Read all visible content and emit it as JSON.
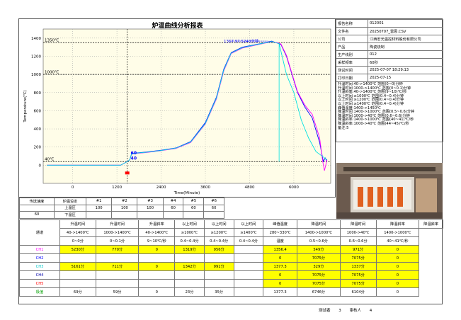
{
  "title": "炉温曲线分析报表",
  "info": [
    {
      "k": "报告名称",
      "v": "012001"
    },
    {
      "k": "文件名",
      "v": "20250707_雷恩.CSV"
    },
    {
      "k": "公司",
      "v": "江西宏光温控材料股份有限公司"
    },
    {
      "k": "产品",
      "v": "陶瓷烧制"
    },
    {
      "k": "生产线别",
      "v": "012"
    },
    {
      "k": "采样频率",
      "v": "60秒"
    },
    {
      "k": "测试时间",
      "v": "2025-07-07 18:29:13"
    },
    {
      "k": "打印日期",
      "v": "2025-07-15"
    }
  ],
  "notes": [
    "升温时间:40->1400℃ 范围(0~0)分钟",
    "升温时间:1000->1400℃ 范围(0~0.1)分钟",
    "升温斜率:40->1400℃ 范围(9~10)℃/秒",
    "以上时间:≥1000℃ 范围(0.4~0.4)分钟",
    "以上时间:≥1200℃ 范围(0.4~0.4)分钟",
    "以上时间:≥1400℃ 范围(0.4~0.4)分钟",
    "峰值温度:1400->1450℃",
    "降温时间:1400->1000℃ 范围(0.5~0.6)分钟",
    "降温时间:1000->40℃ 范围(0.6~0.6)分钟",
    "降温斜率:1400->1000℃ 范围(40~41)℃/秒",
    "降温斜率:1000->40℃ 范围(44~45)℃/秒",
    "备注:5"
  ],
  "chart_data": {
    "type": "line",
    "xlabel": "Time(Minute)",
    "ylabel": "Temperature(℃)",
    "xlim": [
      -800,
      7000
    ],
    "ylim": [
      -200,
      1500
    ],
    "xticks": [
      0,
      1200,
      2400,
      3600,
      4800,
      6000
    ],
    "yticks": [
      0,
      200,
      400,
      600,
      800,
      1000,
      1200,
      1400
    ],
    "ref_lines": [
      {
        "y": 1350,
        "label": "1350℃"
      },
      {
        "y": 1000,
        "label": "1000℃"
      },
      {
        "y": 40,
        "label": "40℃"
      }
    ],
    "vline": 1480,
    "peak_label": "1367.97 5243分钟",
    "start_label": "60",
    "start_label2": "40",
    "series": [
      {
        "color": "#0000ff",
        "x": [
          -700,
          0,
          1300,
          1480,
          1550,
          1600,
          2000,
          2400,
          2800,
          3200,
          3600,
          3900,
          4100,
          4300,
          4600,
          5100,
          5400,
          5550,
          5650,
          5800,
          5950,
          6100,
          6300,
          6500,
          6700,
          6800,
          6850,
          6900
        ],
        "y": [
          0,
          0,
          0,
          40,
          60,
          130,
          145,
          165,
          190,
          260,
          470,
          750,
          1060,
          1240,
          1300,
          1340,
          1367,
          1345,
          1330,
          1200,
          1000,
          800,
          640,
          520,
          250,
          40,
          80,
          40
        ]
      },
      {
        "color": "#ff00ff",
        "x": [
          -700,
          0,
          1300,
          1480,
          1550,
          1600,
          2000,
          2400,
          2800,
          3200,
          3600,
          3900,
          4100,
          4300,
          4600,
          5100,
          5400,
          5550,
          5650,
          5800,
          5950,
          6100,
          6300,
          6500,
          6700,
          6780,
          6830,
          6900
        ],
        "y": [
          0,
          0,
          0,
          40,
          60,
          125,
          140,
          160,
          185,
          250,
          455,
          730,
          1040,
          1230,
          1290,
          1335,
          1360,
          1350,
          1335,
          1210,
          1010,
          810,
          660,
          560,
          300,
          50,
          -60,
          60
        ]
      },
      {
        "color": "#00e0e0",
        "x": [
          -700,
          0,
          1300,
          1480,
          1550,
          1600,
          2000,
          2400,
          2800,
          3200,
          3600,
          3900,
          4100,
          4300,
          4600,
          5100,
          5400,
          5550,
          5600,
          5800,
          6000,
          6200,
          6400,
          6600,
          6800,
          6900
        ],
        "y": [
          0,
          0,
          0,
          40,
          60,
          128,
          143,
          162,
          188,
          255,
          460,
          740,
          1050,
          1235,
          1295,
          1338,
          1362,
          1345,
          1340,
          1000,
          800,
          500,
          300,
          150,
          90,
          60
        ]
      }
    ]
  },
  "speed_table": {
    "r1": [
      "传送速度",
      "炉温设定",
      "#1",
      "#2",
      "#3",
      "#4",
      "#5",
      "#6"
    ],
    "r2": [
      "",
      "上温区",
      "100",
      "100",
      "100",
      "60",
      "60",
      "60"
    ],
    "r3": [
      "60",
      "下温区",
      "",
      "",
      "",
      "",
      "",
      ""
    ]
  },
  "main_table": {
    "h1": [
      "通道",
      "升温时间",
      "升温时间",
      "升温斜率",
      "以上时间",
      "以上时间",
      "以上时间",
      "峰值温度",
      "降温时间",
      "降温时间",
      "降温斜率",
      "降温斜率"
    ],
    "h2": [
      "40->1400℃",
      "1000->1400℃",
      "40->1400℃",
      "≥1000℃",
      "≥1200℃",
      "≥1400℃",
      "280~330℃",
      "1400->1000℃",
      "1000->40℃",
      "1400->1000℃"
    ],
    "h3": [
      "0~0分",
      "0~0.1分",
      "9~10℃/秒",
      "0.4~0.4分",
      "0.4~0.4分",
      "0.4~0.4分",
      "温度",
      "0.5~0.6分",
      "0.6~0.6分",
      "40~41℃/秒"
    ],
    "rows": [
      {
        "name": "CH1",
        "color": "#ff00ff",
        "cells": [
          "5230分",
          "770分",
          "0",
          "1319分",
          "956分",
          "",
          "1356.4",
          "549分",
          "971分",
          "0"
        ],
        "yellow": [
          0,
          1,
          2,
          3,
          4,
          6,
          7,
          8,
          9
        ]
      },
      {
        "name": "CH2",
        "color": "#0000ff",
        "cells": [
          "",
          "",
          "",
          "",
          "",
          "",
          "0",
          "7075分",
          "7075分",
          "0"
        ],
        "yellow": [
          6,
          7,
          8,
          9
        ]
      },
      {
        "name": "CH3",
        "color": "#00c8c8",
        "cells": [
          "5161分",
          "711分",
          "0",
          "1342分",
          "991分",
          "",
          "1377.3",
          "329分",
          "1337分",
          "0"
        ],
        "yellow": [
          0,
          1,
          2,
          3,
          4,
          6,
          7,
          8,
          9
        ]
      },
      {
        "name": "CH4",
        "color": "#0000aa",
        "cells": [
          "",
          "",
          "",
          "",
          "",
          "",
          "0",
          "7075分",
          "7075分",
          "0"
        ],
        "yellow": [
          6,
          7,
          8,
          9
        ]
      },
      {
        "name": "CH5",
        "color": "#ff0000",
        "cells": [
          "",
          "",
          "",
          "",
          "",
          "",
          "0",
          "7075分",
          "7075分",
          "0"
        ],
        "yellow": [
          6,
          7,
          8,
          9
        ]
      },
      {
        "name": "极值",
        "color": "#00a000",
        "cells": [
          "69分",
          "59分",
          "0",
          "23分",
          "35分",
          "",
          "1377.3",
          "6746分",
          "6104分",
          "0"
        ],
        "yellow": []
      }
    ]
  },
  "footer": {
    "tester": "测试者",
    "tester_v": "3",
    "auditor": "审核人",
    "auditor_v": "4"
  }
}
